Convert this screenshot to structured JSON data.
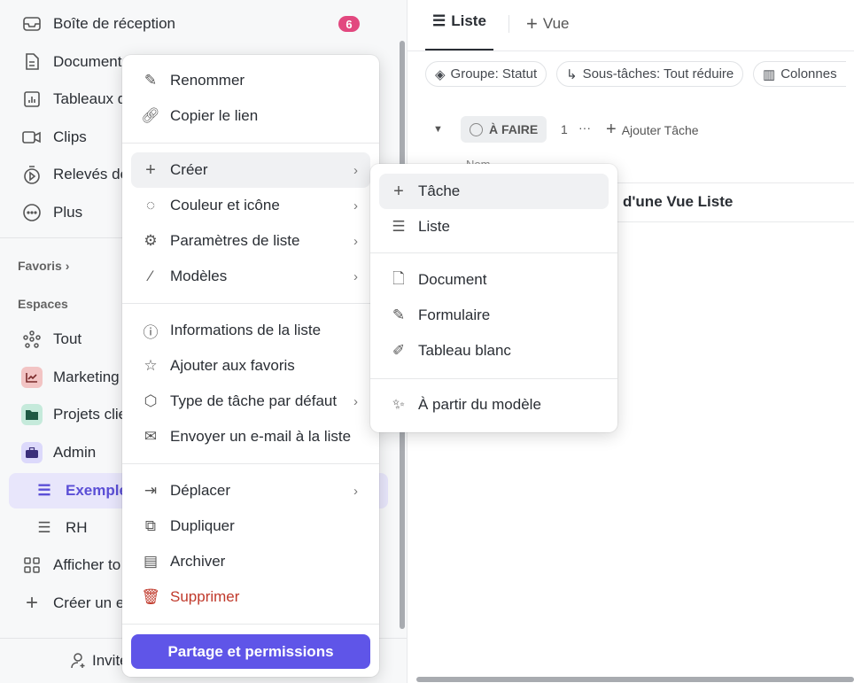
{
  "sidebar": {
    "top_items": [
      {
        "label": "Boîte de réception",
        "icon": "inbox-icon",
        "badge": "6"
      },
      {
        "label": "Document",
        "icon": "document-icon"
      },
      {
        "label": "Tableaux d",
        "icon": "dashboard-icon"
      },
      {
        "label": "Clips",
        "icon": "video-icon"
      },
      {
        "label": "Relevés de",
        "icon": "timer-icon"
      },
      {
        "label": "Plus",
        "icon": "more-icon"
      }
    ],
    "favorites_label": "Favoris",
    "spaces_label": "Espaces",
    "spaces": [
      {
        "label": "Tout",
        "icon": "hub-icon"
      },
      {
        "label": "Marketing",
        "icon": "chart-icon",
        "color": "#f2c4c4"
      },
      {
        "label": "Projets clie",
        "icon": "folder-icon",
        "color": "#c5eadb"
      },
      {
        "label": "Admin",
        "icon": "briefcase-icon",
        "color": "#dcd9fb"
      },
      {
        "label": "Exemple",
        "icon": "list-icon",
        "active": true
      },
      {
        "label": "RH",
        "icon": "list-icon"
      },
      {
        "label": "Afficher to",
        "icon": "grid-icon"
      },
      {
        "label": "Créer un e",
        "icon": "plus-icon"
      }
    ],
    "invite_label": "Invite"
  },
  "main": {
    "tabs": [
      {
        "label": "Liste",
        "active": true
      },
      {
        "label": "Vue"
      }
    ],
    "chips": [
      "Groupe: Statut",
      "Sous-tâches: Tout réduire",
      "Colonnes"
    ],
    "group": {
      "status": "À FAIRE",
      "count": "1",
      "add_task": "Ajouter Tâche"
    },
    "column_header": "Nom",
    "task": "d'une Vue Liste"
  },
  "context_menu": {
    "items": [
      "Renommer",
      "Copier le lien",
      "Créer",
      "Couleur et icône",
      "Paramètres de liste",
      "Modèles",
      "Informations de la liste",
      "Ajouter aux favoris",
      "Type de tâche par défaut",
      "Envoyer un e-mail à la liste",
      "Déplacer",
      "Dupliquer",
      "Archiver",
      "Supprimer"
    ],
    "share_button": "Partage et permissions"
  },
  "submenu": {
    "items": [
      "Tâche",
      "Liste",
      "Document",
      "Formulaire",
      "Tableau blanc",
      "À partir du modèle"
    ]
  },
  "colors": {
    "accent": "#5f55e8",
    "badge": "#e2487f",
    "danger": "#c0392b"
  }
}
